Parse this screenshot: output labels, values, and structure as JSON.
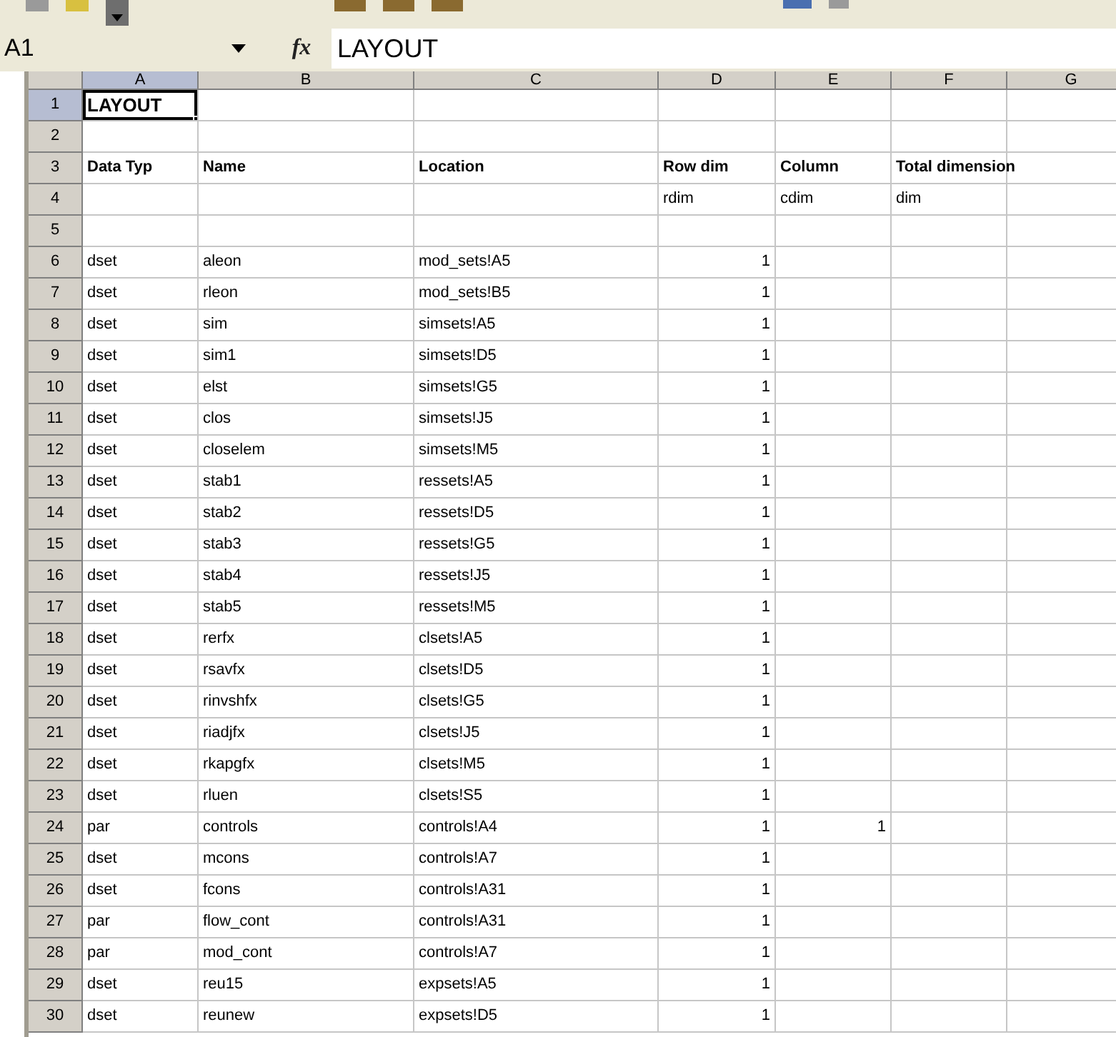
{
  "formula_bar": {
    "name_box": "A1",
    "function_label": "fx",
    "formula": "LAYOUT"
  },
  "columns": [
    {
      "label": "A",
      "selected": true
    },
    {
      "label": "B",
      "selected": false
    },
    {
      "label": "C",
      "selected": false
    },
    {
      "label": "D",
      "selected": false
    },
    {
      "label": "E",
      "selected": false
    },
    {
      "label": "F",
      "selected": false
    },
    {
      "label": "G",
      "selected": false
    }
  ],
  "rows": [
    {
      "number": "1",
      "selected": true,
      "kind": "title",
      "cells": [
        "LAYOUT",
        "",
        "",
        "",
        "",
        "",
        ""
      ]
    },
    {
      "number": "2",
      "selected": false,
      "kind": "text",
      "cells": [
        "",
        "",
        "",
        "",
        "",
        "",
        ""
      ]
    },
    {
      "number": "3",
      "selected": false,
      "kind": "header",
      "cells": [
        "Data Typ",
        "Name",
        "Location",
        "Row dim",
        "Column",
        "Total dimension",
        ""
      ]
    },
    {
      "number": "4",
      "selected": false,
      "kind": "text",
      "cells": [
        "",
        "",
        "",
        "rdim",
        "cdim",
        "dim",
        ""
      ]
    },
    {
      "number": "5",
      "selected": false,
      "kind": "text",
      "cells": [
        "",
        "",
        "",
        "",
        "",
        "",
        ""
      ]
    },
    {
      "number": "6",
      "selected": false,
      "kind": "data",
      "cells": [
        "dset",
        "aleon",
        "mod_sets!A5",
        "1",
        "",
        "",
        ""
      ]
    },
    {
      "number": "7",
      "selected": false,
      "kind": "data",
      "cells": [
        "dset",
        "rleon",
        "mod_sets!B5",
        "1",
        "",
        "",
        ""
      ]
    },
    {
      "number": "8",
      "selected": false,
      "kind": "data",
      "cells": [
        "dset",
        "sim",
        "simsets!A5",
        "1",
        "",
        "",
        ""
      ]
    },
    {
      "number": "9",
      "selected": false,
      "kind": "data",
      "cells": [
        "dset",
        "sim1",
        "simsets!D5",
        "1",
        "",
        "",
        ""
      ]
    },
    {
      "number": "10",
      "selected": false,
      "kind": "data",
      "cells": [
        "dset",
        "elst",
        "simsets!G5",
        "1",
        "",
        "",
        ""
      ]
    },
    {
      "number": "11",
      "selected": false,
      "kind": "data",
      "cells": [
        "dset",
        "clos",
        "simsets!J5",
        "1",
        "",
        "",
        ""
      ]
    },
    {
      "number": "12",
      "selected": false,
      "kind": "data",
      "cells": [
        "dset",
        "closelem",
        "simsets!M5",
        "1",
        "",
        "",
        ""
      ]
    },
    {
      "number": "13",
      "selected": false,
      "kind": "data",
      "cells": [
        "dset",
        "stab1",
        "ressets!A5",
        "1",
        "",
        "",
        ""
      ]
    },
    {
      "number": "14",
      "selected": false,
      "kind": "data",
      "cells": [
        "dset",
        "stab2",
        "ressets!D5",
        "1",
        "",
        "",
        ""
      ]
    },
    {
      "number": "15",
      "selected": false,
      "kind": "data",
      "cells": [
        "dset",
        "stab3",
        "ressets!G5",
        "1",
        "",
        "",
        ""
      ]
    },
    {
      "number": "16",
      "selected": false,
      "kind": "data",
      "cells": [
        "dset",
        "stab4",
        "ressets!J5",
        "1",
        "",
        "",
        ""
      ]
    },
    {
      "number": "17",
      "selected": false,
      "kind": "data",
      "cells": [
        "dset",
        "stab5",
        "ressets!M5",
        "1",
        "",
        "",
        ""
      ]
    },
    {
      "number": "18",
      "selected": false,
      "kind": "data",
      "cells": [
        "dset",
        "rerfx",
        "clsets!A5",
        "1",
        "",
        "",
        ""
      ]
    },
    {
      "number": "19",
      "selected": false,
      "kind": "data",
      "cells": [
        "dset",
        "rsavfx",
        "clsets!D5",
        "1",
        "",
        "",
        ""
      ]
    },
    {
      "number": "20",
      "selected": false,
      "kind": "data",
      "cells": [
        "dset",
        "rinvshfx",
        "clsets!G5",
        "1",
        "",
        "",
        ""
      ]
    },
    {
      "number": "21",
      "selected": false,
      "kind": "data",
      "cells": [
        "dset",
        "riadjfx",
        "clsets!J5",
        "1",
        "",
        "",
        ""
      ]
    },
    {
      "number": "22",
      "selected": false,
      "kind": "data",
      "cells": [
        "dset",
        "rkapgfx",
        "clsets!M5",
        "1",
        "",
        "",
        ""
      ]
    },
    {
      "number": "23",
      "selected": false,
      "kind": "data",
      "cells": [
        "dset",
        "rluen",
        "clsets!S5",
        "1",
        "",
        "",
        ""
      ]
    },
    {
      "number": "24",
      "selected": false,
      "kind": "data",
      "cells": [
        "par",
        "controls",
        "controls!A4",
        "1",
        "1",
        "",
        ""
      ]
    },
    {
      "number": "25",
      "selected": false,
      "kind": "data",
      "cells": [
        "dset",
        "mcons",
        "controls!A7",
        "1",
        "",
        "",
        ""
      ]
    },
    {
      "number": "26",
      "selected": false,
      "kind": "data",
      "cells": [
        "dset",
        "fcons",
        "controls!A31",
        "1",
        "",
        "",
        ""
      ]
    },
    {
      "number": "27",
      "selected": false,
      "kind": "data",
      "cells": [
        "par",
        "flow_cont",
        "controls!A31",
        "1",
        "",
        "",
        ""
      ]
    },
    {
      "number": "28",
      "selected": false,
      "kind": "data",
      "cells": [
        "par",
        "mod_cont",
        "controls!A7",
        "1",
        "",
        "",
        ""
      ]
    },
    {
      "number": "29",
      "selected": false,
      "kind": "data",
      "cells": [
        "dset",
        "reu15",
        "expsets!A5",
        "1",
        "",
        "",
        ""
      ]
    },
    {
      "number": "30",
      "selected": false,
      "kind": "data",
      "cells": [
        "dset",
        "reunew",
        "expsets!D5",
        "1",
        "",
        "",
        ""
      ]
    }
  ]
}
